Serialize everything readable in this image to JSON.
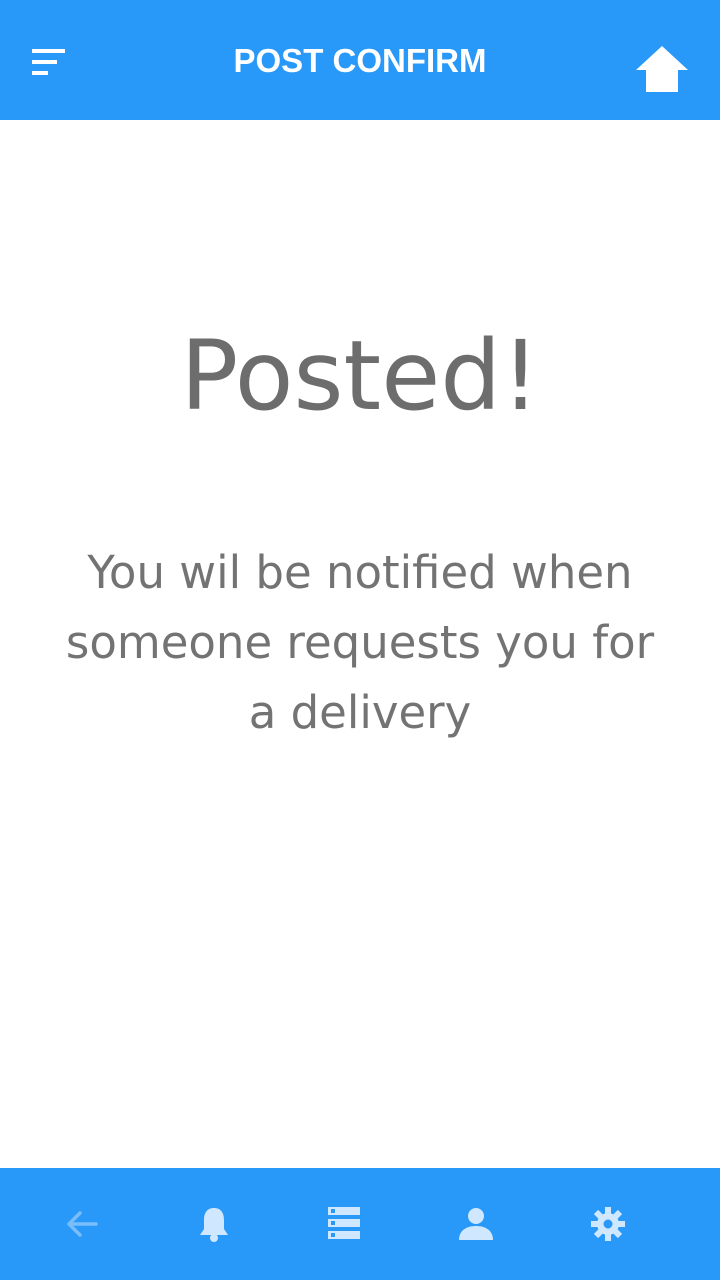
{
  "header": {
    "title": "POST CONFIRM",
    "menu_icon": "menu-icon",
    "home_icon": "home-icon"
  },
  "main": {
    "headline": "Posted!",
    "message": "You wil be notified when someone requests you for a delivery"
  },
  "bottom_nav": {
    "items": [
      {
        "icon": "back-arrow-icon"
      },
      {
        "icon": "bell-icon"
      },
      {
        "icon": "list-icon"
      },
      {
        "icon": "person-icon"
      },
      {
        "icon": "gear-icon"
      }
    ]
  },
  "colors": {
    "accent": "#2899f8",
    "text_gray": "#6d6d6d",
    "icon_light": "#cfe8ff"
  }
}
